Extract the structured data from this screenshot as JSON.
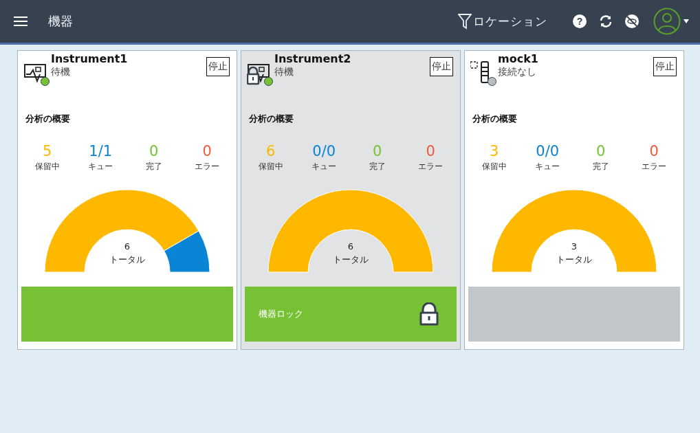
{
  "header": {
    "title": "機器",
    "location_filter": "ロケーション",
    "help": "?"
  },
  "instruments": [
    {
      "name": "Instrument1",
      "status": "待機",
      "color": "#76c234",
      "kind": "instrument",
      "locked": false,
      "stop_button": "停止",
      "summary_title": "分析の概要",
      "stats": [
        {
          "value": "5",
          "label": "保留中",
          "color": "#ffb800"
        },
        {
          "value": "1/1",
          "label": "キュー",
          "color": "#0a84d4"
        },
        {
          "value": "0",
          "label": "完了",
          "color": "#76c234"
        },
        {
          "value": "0",
          "label": "エラー",
          "color": "#f05a3c"
        }
      ],
      "total_value": "6",
      "total_label": "トータル",
      "panel": {
        "kind": "ready"
      }
    },
    {
      "name": "Instrument2",
      "status": "待機",
      "color": "#76c234",
      "kind": "instrument",
      "locked": true,
      "stop_button": "停止",
      "summary_title": "分析の概要",
      "stats": [
        {
          "value": "6",
          "label": "保留中",
          "color": "#ffb800"
        },
        {
          "value": "0/0",
          "label": "キュー",
          "color": "#0a84d4"
        },
        {
          "value": "0",
          "label": "完了",
          "color": "#76c234"
        },
        {
          "value": "0",
          "label": "エラー",
          "color": "#f05a3c"
        }
      ],
      "total_value": "6",
      "total_label": "トータル",
      "panel": {
        "kind": "locked",
        "text": "機器ロック"
      }
    },
    {
      "name": "mock1",
      "status": "接続なし",
      "color": "#b9bec2",
      "kind": "mock",
      "locked": false,
      "stop_button": "停止",
      "summary_title": "分析の概要",
      "stats": [
        {
          "value": "3",
          "label": "保留中",
          "color": "#ffb800"
        },
        {
          "value": "0/0",
          "label": "キュー",
          "color": "#0a84d4"
        },
        {
          "value": "0",
          "label": "完了",
          "color": "#76c234"
        },
        {
          "value": "0",
          "label": "エラー",
          "color": "#f05a3c"
        }
      ],
      "total_value": "3",
      "total_label": "トータル",
      "panel": {
        "kind": "offline"
      }
    }
  ]
}
